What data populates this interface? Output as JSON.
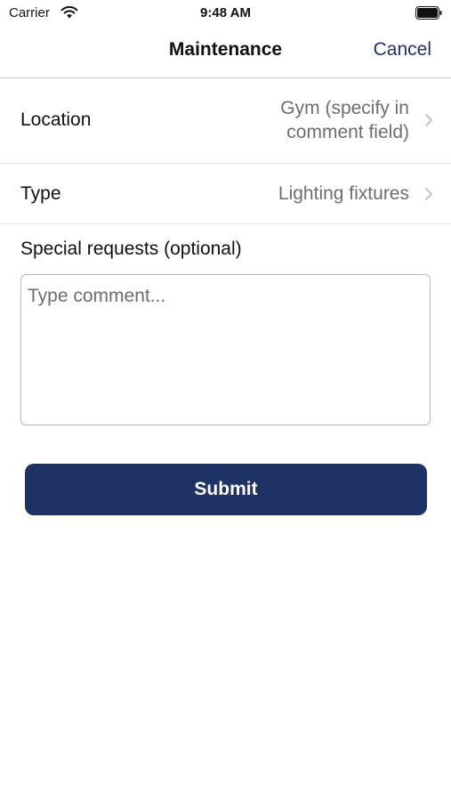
{
  "status_bar": {
    "carrier": "Carrier",
    "time": "9:48 AM",
    "wifi_icon": "wifi-icon",
    "battery_icon": "battery-icon"
  },
  "nav": {
    "title": "Maintenance",
    "cancel_label": "Cancel"
  },
  "form": {
    "rows": [
      {
        "label": "Location",
        "value": "Gym (specify in comment field)",
        "icon": "chevron-right-icon"
      },
      {
        "label": "Type",
        "value": "Lighting fixtures",
        "icon": "chevron-right-icon"
      }
    ],
    "special_requests_label": "Special requests (optional)",
    "comment_placeholder": "Type comment...",
    "comment_value": ""
  },
  "submit_label": "Submit",
  "colors": {
    "accent": "#1f3266",
    "secondary_text": "#6d6d72",
    "separator": "#e2e2e5"
  }
}
